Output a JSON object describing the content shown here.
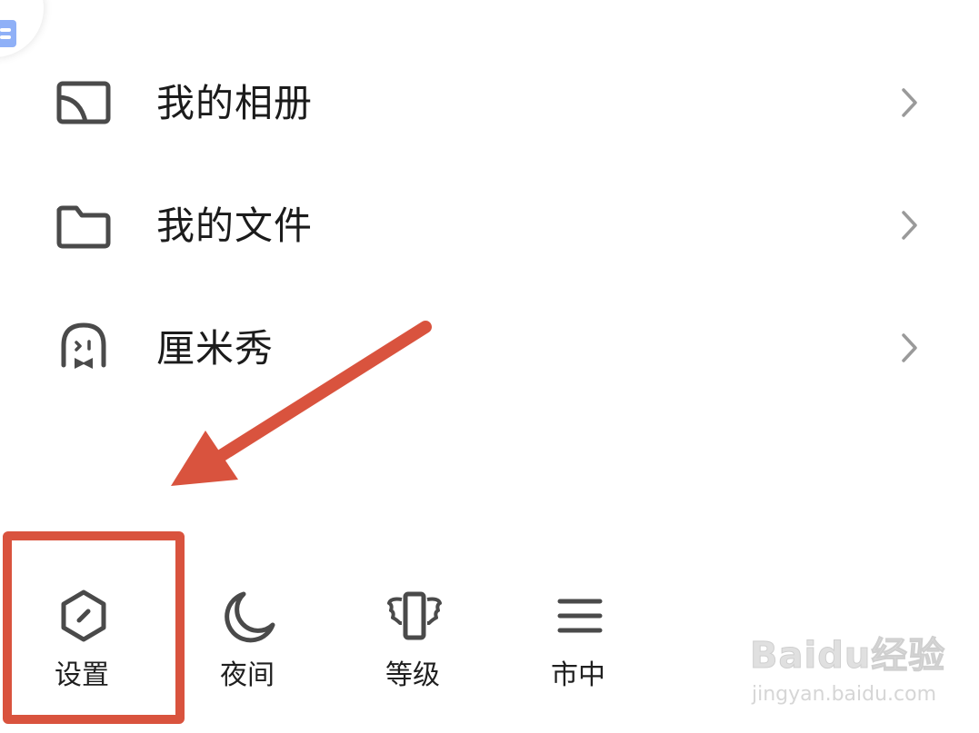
{
  "menu": {
    "items": [
      {
        "label": "我的相册",
        "icon": "album-icon"
      },
      {
        "label": "我的文件",
        "icon": "folder-icon"
      },
      {
        "label": "厘米秀",
        "icon": "ghost-icon"
      }
    ]
  },
  "toolbar": {
    "items": [
      {
        "label": "设置",
        "icon": "settings-hexagon-icon"
      },
      {
        "label": "夜间",
        "icon": "moon-icon"
      },
      {
        "label": "等级",
        "icon": "trophy-wings-icon"
      },
      {
        "label": "市中",
        "icon": "menu-lines-icon"
      }
    ]
  },
  "annotation": {
    "highlight_color": "#d9533e",
    "arrow_color": "#d9533e"
  },
  "watermark": {
    "brand": "Baidu经验",
    "site": "jingyan.baidu.com"
  },
  "colors": {
    "text": "#1b1b1b",
    "icon": "#4a4a4a",
    "chevron": "#9a9a9a",
    "avatar_badge": "#8fb0f7"
  }
}
